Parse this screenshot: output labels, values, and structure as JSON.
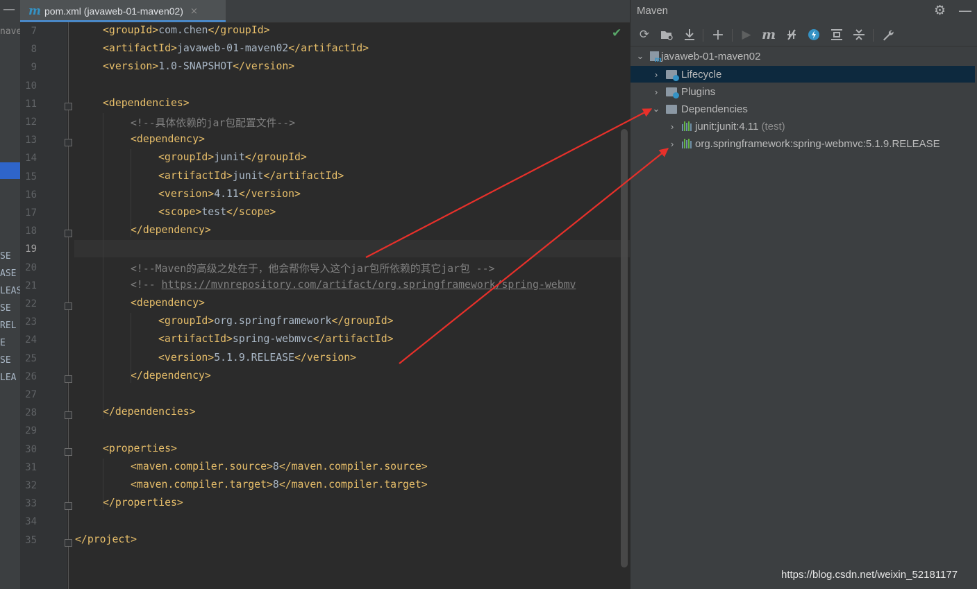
{
  "left_strip": {
    "fragments": [
      {
        "text": "nave"
      },
      {
        "text": "SE"
      },
      {
        "text": "ASE"
      },
      {
        "text": "LEAS"
      },
      {
        "text": "SE"
      },
      {
        "text": "REL"
      },
      {
        "text": "E"
      },
      {
        "text": "SE"
      },
      {
        "text": "LEA"
      }
    ]
  },
  "editor": {
    "tab": {
      "icon": "maven-file-icon",
      "icon_glyph": "m",
      "title": "pom.xml (javaweb-01-maven02)",
      "close_glyph": "×"
    },
    "current_line": "19",
    "lines": [
      {
        "num": "7",
        "parts": [
          {
            "c": "tag",
            "t": "<groupId>"
          },
          {
            "c": "txt",
            "t": "com.chen"
          },
          {
            "c": "tag",
            "t": "</groupId>"
          }
        ]
      },
      {
        "num": "8",
        "parts": [
          {
            "c": "tag",
            "t": "<artifactId>"
          },
          {
            "c": "txt",
            "t": "javaweb-01-maven02"
          },
          {
            "c": "tag",
            "t": "</artifactId>"
          }
        ]
      },
      {
        "num": "9",
        "parts": [
          {
            "c": "tag",
            "t": "<version>"
          },
          {
            "c": "txt",
            "t": "1.0-SNAPSHOT"
          },
          {
            "c": "tag",
            "t": "</version>"
          }
        ]
      },
      {
        "num": "10",
        "parts": []
      },
      {
        "num": "11",
        "parts": [
          {
            "c": "tag",
            "t": "<dependencies>"
          }
        ]
      },
      {
        "num": "12",
        "parts": [
          {
            "c": "cm",
            "t": "<!--具体依赖的jar包配置文件-->"
          }
        ]
      },
      {
        "num": "13",
        "parts": [
          {
            "c": "tag",
            "t": "<dependency>"
          }
        ]
      },
      {
        "num": "14",
        "parts": [
          {
            "c": "tag",
            "t": "<groupId>"
          },
          {
            "c": "txt",
            "t": "junit"
          },
          {
            "c": "tag",
            "t": "</groupId>"
          }
        ]
      },
      {
        "num": "15",
        "parts": [
          {
            "c": "tag",
            "t": "<artifactId>"
          },
          {
            "c": "txt",
            "t": "junit"
          },
          {
            "c": "tag",
            "t": "</artifactId>"
          }
        ]
      },
      {
        "num": "16",
        "parts": [
          {
            "c": "tag",
            "t": "<version>"
          },
          {
            "c": "txt",
            "t": "4.11"
          },
          {
            "c": "tag",
            "t": "</version>"
          }
        ]
      },
      {
        "num": "17",
        "parts": [
          {
            "c": "tag",
            "t": "<scope>"
          },
          {
            "c": "txt",
            "t": "test"
          },
          {
            "c": "tag",
            "t": "</scope>"
          }
        ]
      },
      {
        "num": "18",
        "parts": [
          {
            "c": "tag",
            "t": "</dependency>"
          }
        ]
      },
      {
        "num": "19",
        "parts": []
      },
      {
        "num": "20",
        "parts": [
          {
            "c": "cm",
            "t": "<!--Maven的高级之处在于，他会帮你导入这个jar包所依赖的其它jar包 -->"
          }
        ]
      },
      {
        "num": "21",
        "parts": [
          {
            "c": "cm",
            "t": "<!-- "
          },
          {
            "c": "url",
            "t": "https://mvnrepository.com/artifact/org.springframework/spring-webmv"
          }
        ]
      },
      {
        "num": "22",
        "parts": [
          {
            "c": "tag",
            "t": "<dependency>"
          }
        ]
      },
      {
        "num": "23",
        "parts": [
          {
            "c": "tag",
            "t": "<groupId>"
          },
          {
            "c": "txt",
            "t": "org.springframework"
          },
          {
            "c": "tag",
            "t": "</groupId>"
          }
        ]
      },
      {
        "num": "24",
        "parts": [
          {
            "c": "tag",
            "t": "<artifactId>"
          },
          {
            "c": "txt",
            "t": "spring-webmvc"
          },
          {
            "c": "tag",
            "t": "</artifactId>"
          }
        ]
      },
      {
        "num": "25",
        "parts": [
          {
            "c": "tag",
            "t": "<version>"
          },
          {
            "c": "txt",
            "t": "5.1.9.RELEASE"
          },
          {
            "c": "tag",
            "t": "</version>"
          }
        ]
      },
      {
        "num": "26",
        "parts": [
          {
            "c": "tag",
            "t": "</dependency>"
          }
        ]
      },
      {
        "num": "27",
        "parts": []
      },
      {
        "num": "28",
        "parts": [
          {
            "c": "tag",
            "t": "</dependencies>"
          }
        ]
      },
      {
        "num": "29",
        "parts": []
      },
      {
        "num": "30",
        "parts": [
          {
            "c": "tag",
            "t": "<properties>"
          }
        ]
      },
      {
        "num": "31",
        "parts": [
          {
            "c": "tag",
            "t": "<maven.compiler.source>"
          },
          {
            "c": "txt",
            "t": "8"
          },
          {
            "c": "tag",
            "t": "</maven.compiler.source>"
          }
        ]
      },
      {
        "num": "32",
        "parts": [
          {
            "c": "tag",
            "t": "<maven.compiler.target>"
          },
          {
            "c": "txt",
            "t": "8"
          },
          {
            "c": "tag",
            "t": "</maven.compiler.target>"
          }
        ]
      },
      {
        "num": "33",
        "parts": [
          {
            "c": "tag",
            "t": "</properties>"
          }
        ]
      },
      {
        "num": "34",
        "parts": []
      },
      {
        "num": "35",
        "parts": [
          {
            "c": "tag",
            "t": "</project>"
          }
        ]
      }
    ],
    "inspection_icon": "checkmark-icon"
  },
  "maven": {
    "title": "Maven",
    "header_icons": [
      {
        "name": "gear-icon"
      },
      {
        "name": "hide-icon"
      }
    ],
    "toolbar": [
      {
        "name": "reload-icon"
      },
      {
        "name": "add-folder-icon"
      },
      {
        "name": "download-icon"
      },
      {
        "name": "add-icon"
      },
      {
        "name": "run-icon"
      },
      {
        "name": "execute-goal-icon"
      },
      {
        "name": "toggle-offline-icon"
      },
      {
        "name": "skip-tests-icon"
      },
      {
        "name": "show-dependencies-icon"
      },
      {
        "name": "collapse-all-icon"
      },
      {
        "name": "settings-wrench-icon"
      }
    ],
    "tree": {
      "project": "javaweb-01-maven02",
      "lifecycle": "Lifecycle",
      "plugins": "Plugins",
      "dependencies": "Dependencies",
      "deps": [
        {
          "label": "junit:junit:4.11",
          "scope": "(test)"
        },
        {
          "label": "org.springframework:spring-webmvc:5.1.9.RELEASE",
          "scope": ""
        }
      ]
    }
  },
  "colors": {
    "annotation_arrow": "#e8302a",
    "tag": "#e8bf6a",
    "comment": "#808080",
    "selection": "#0d293e"
  },
  "watermark": "https://blog.csdn.net/weixin_52181177"
}
